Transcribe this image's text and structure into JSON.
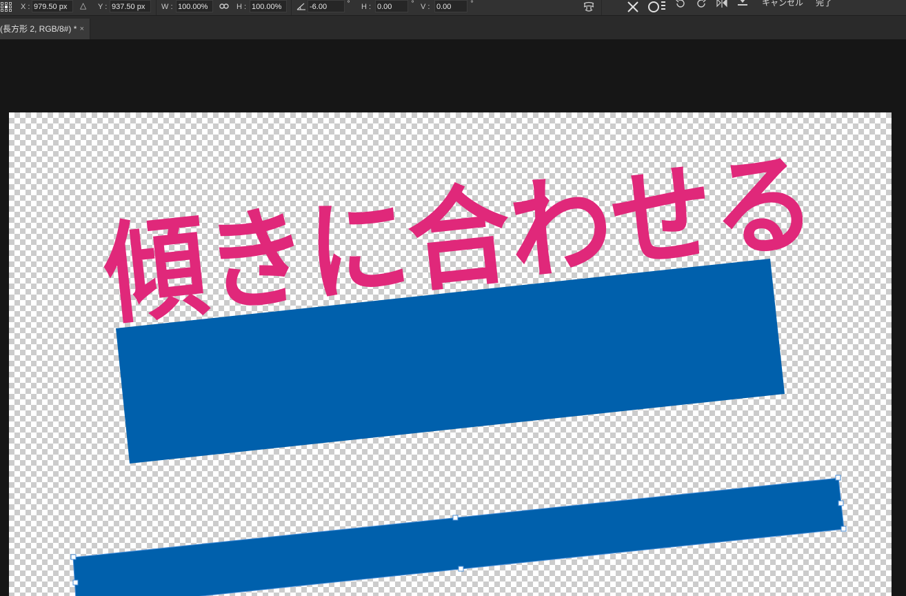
{
  "options_bar": {
    "x_label": "X :",
    "x_value": "979.50 px",
    "y_label": "Y :",
    "y_value": "937.50 px",
    "w_label": "W :",
    "w_value": "100.00%",
    "h_label": "H :",
    "h_value": "100.00%",
    "angle_value": "-6.00",
    "skew_h_label": "H :",
    "skew_h_value": "0.00",
    "skew_v_label": "V :",
    "skew_v_value": "0.00",
    "degree_symbol": "°",
    "cancel_label": "キャンセル",
    "done_label": "完了"
  },
  "document_tab": {
    "title": "(長方形 2, RGB/8#) *",
    "close": "×"
  },
  "canvas": {
    "headline": "傾きに合わせる",
    "colors": {
      "text": "#e0287a",
      "rectangle": "#0060ac",
      "handle_stroke": "#4a8ed6"
    }
  },
  "icons": [
    "reference-point-icon",
    "delta-icon",
    "link-icon",
    "angle-icon",
    "warp-icon",
    "cancel-x-icon",
    "commit-circle-icon",
    "undo-icon",
    "redo-icon",
    "flip-icon",
    "puppet-icon"
  ]
}
